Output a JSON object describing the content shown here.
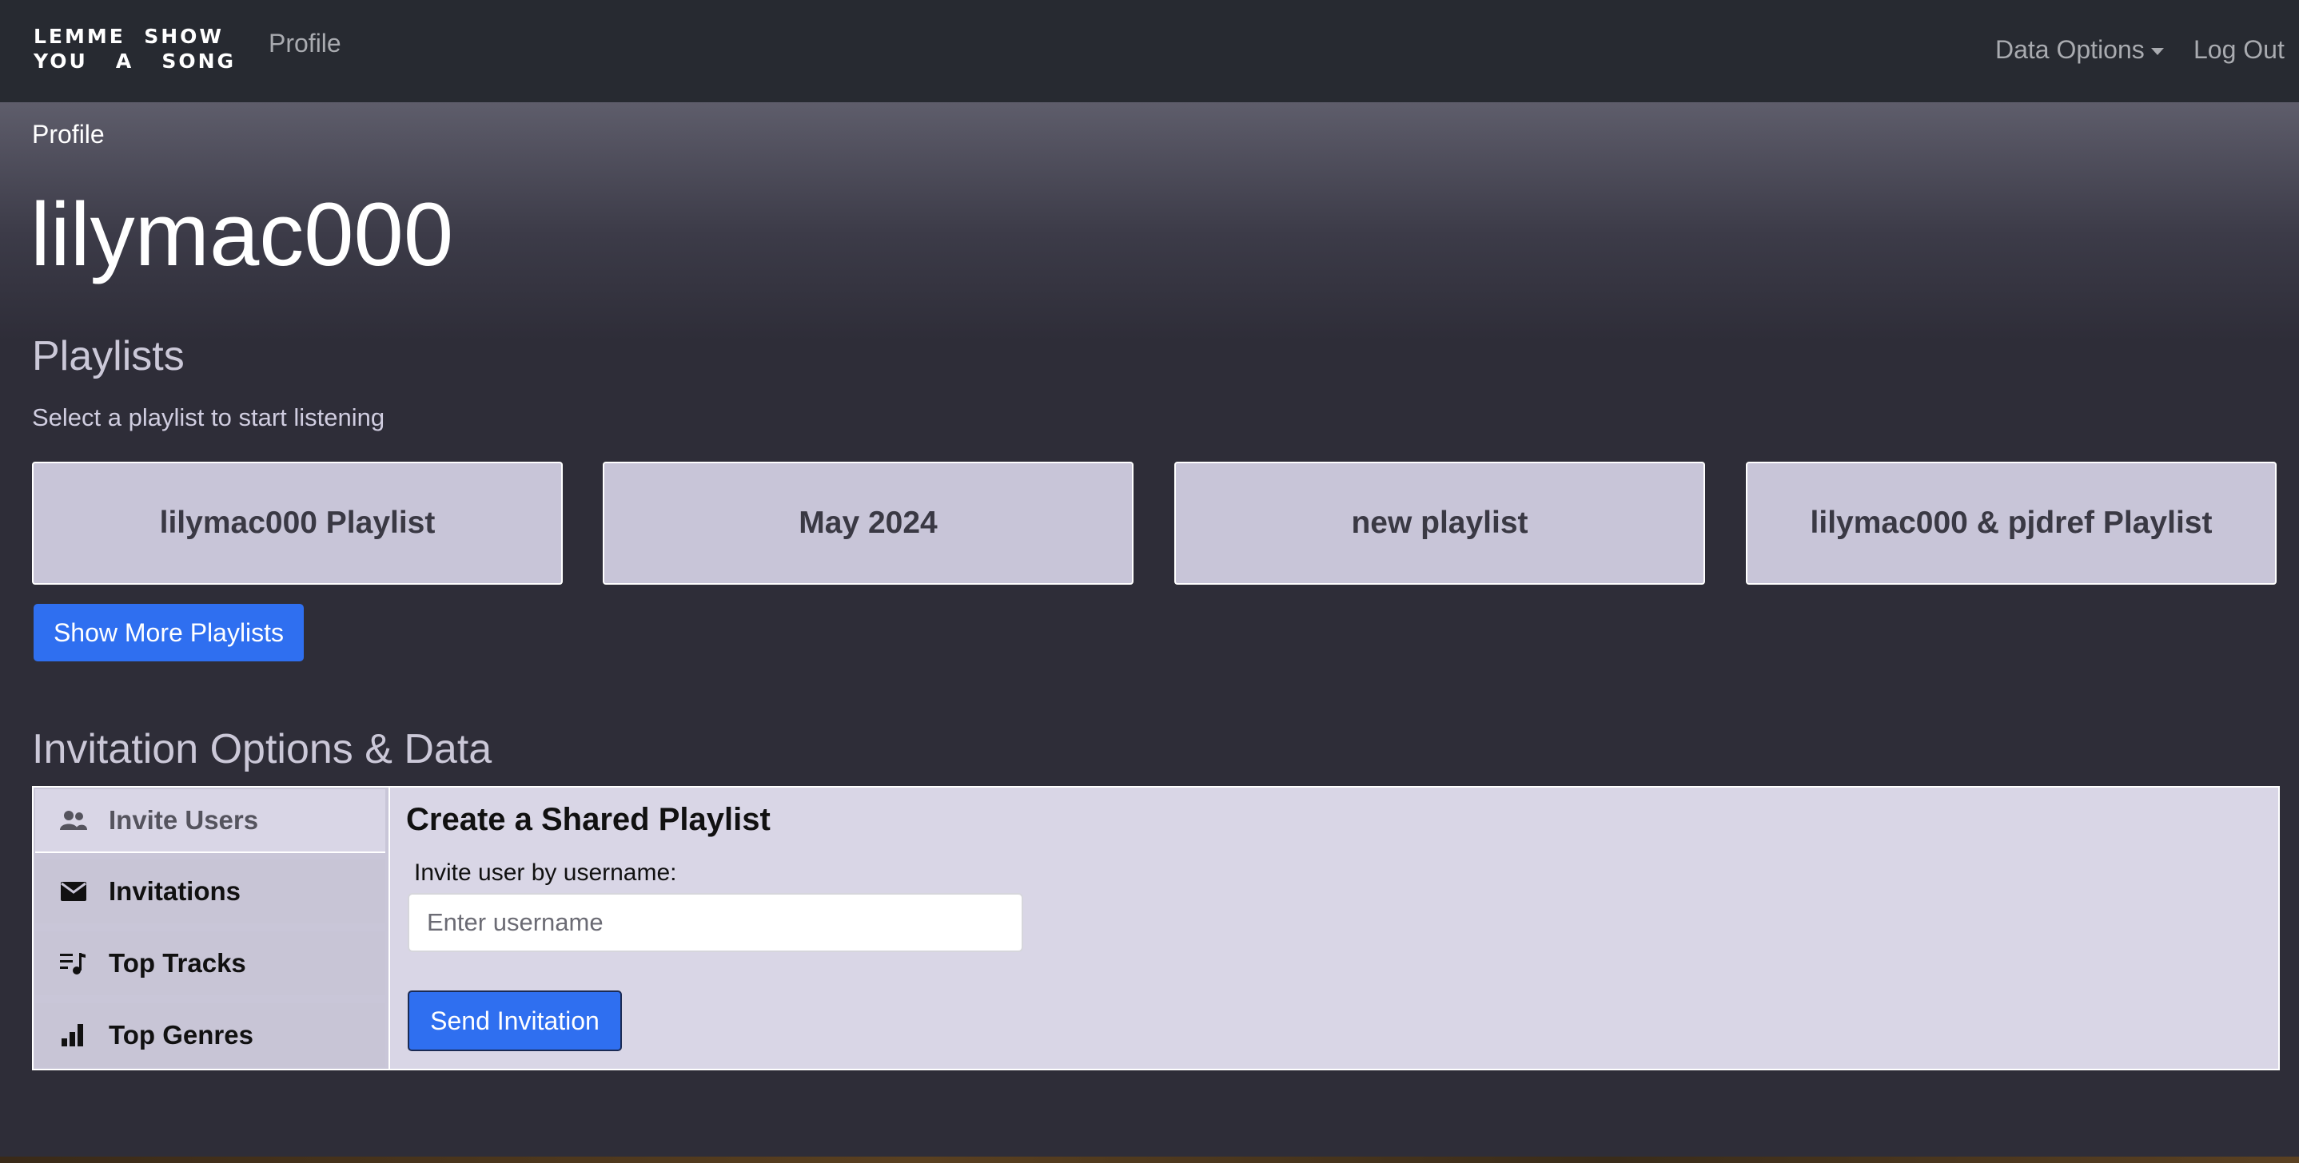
{
  "navbar": {
    "logo_line1": "LEMME  SHOW",
    "logo_line2": "YOU   A   SONG",
    "profile_link": "Profile",
    "data_options": "Data Options",
    "logout": "Log Out"
  },
  "breadcrumb": "Profile",
  "username": "lilymac000",
  "playlists": {
    "title": "Playlists",
    "subtitle": "Select a playlist to start listening",
    "items": [
      {
        "label": "lilymac000 Playlist"
      },
      {
        "label": "May 2024"
      },
      {
        "label": "new playlist"
      },
      {
        "label": "lilymac000 & pjdref Playlist"
      }
    ],
    "show_more": "Show More Playlists"
  },
  "invitation": {
    "title": "Invitation Options & Data",
    "tabs": [
      {
        "label": "Invite Users",
        "icon": "users-icon",
        "active": true
      },
      {
        "label": "Invitations",
        "icon": "envelope-icon",
        "active": false
      },
      {
        "label": "Top Tracks",
        "icon": "music-list-icon",
        "active": false
      },
      {
        "label": "Top Genres",
        "icon": "bar-chart-icon",
        "active": false
      }
    ],
    "form": {
      "title": "Create a Shared Playlist",
      "label": "Invite user by username:",
      "placeholder": "Enter username",
      "value": "",
      "submit": "Send Invitation"
    }
  },
  "colors": {
    "navbar_bg": "#272a31",
    "page_bg": "#2e2d38",
    "card_bg": "#c8c5d8",
    "primary": "#2f6ff0"
  }
}
